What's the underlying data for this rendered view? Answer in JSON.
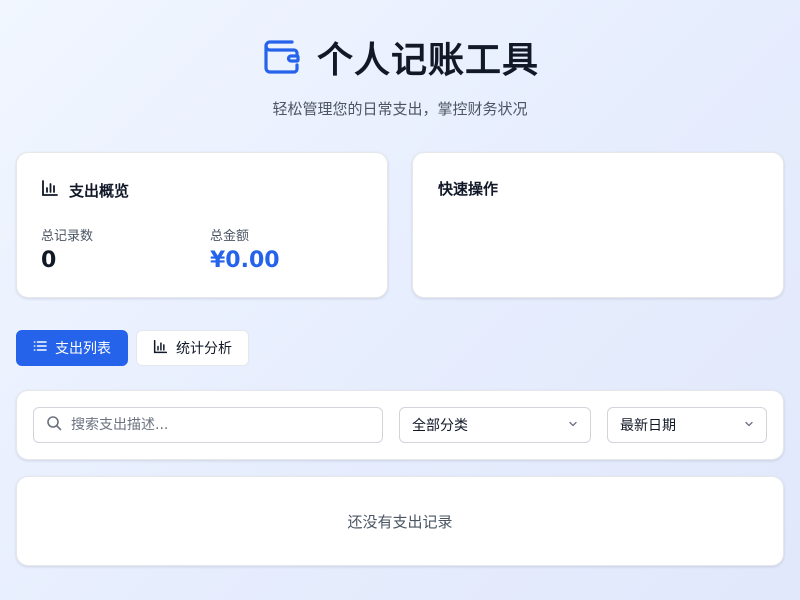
{
  "header": {
    "title": "个人记账工具",
    "subtitle": "轻松管理您的日常支出，掌控财务状况",
    "icon": "wallet-icon",
    "accent": "#2563eb"
  },
  "overview": {
    "title": "支出概览",
    "icon": "bar-chart-icon",
    "records_label": "总记录数",
    "records_value": "0",
    "amount_label": "总金额",
    "amount_value": "¥0.00"
  },
  "quick_actions": {
    "title": "快速操作"
  },
  "tabs": [
    {
      "label": "支出列表",
      "icon": "list-icon",
      "active": true
    },
    {
      "label": "统计分析",
      "icon": "bar-chart-icon",
      "active": false
    }
  ],
  "filters": {
    "search_placeholder": "搜索支出描述...",
    "search_value": "",
    "category_selected": "全部分类",
    "sort_selected": "最新日期"
  },
  "expense_list": {
    "empty_text": "还没有支出记录"
  }
}
